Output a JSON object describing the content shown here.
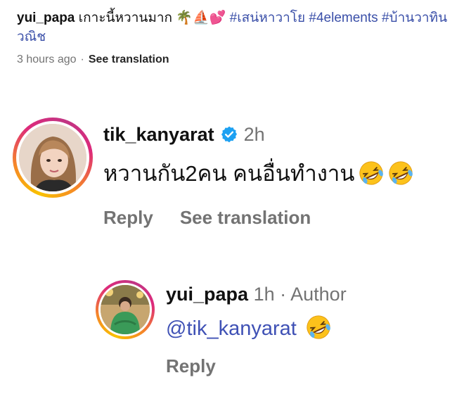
{
  "caption": {
    "username": "yui_papa",
    "text": "เกาะนี้หวานมาก",
    "emojis": "🌴⛵💕",
    "hashtags": [
      "#เสน่หาวาโย",
      "#4elements",
      "#บ้านวาทิน",
      "วณิช"
    ],
    "time": "3 hours ago",
    "see_translation": "See translation"
  },
  "comments": [
    {
      "username": "tik_kanyarat",
      "verified": true,
      "time": "2h",
      "text": "หวานกัน2คน คนอื่นทำงาน",
      "emoji": "rolling-on-floor-laughing",
      "reply_label": "Reply",
      "see_translation": "See translation"
    },
    {
      "username": "yui_papa",
      "time": "1h",
      "separator": "·",
      "author_label": "Author",
      "mention": "@tik_kanyarat",
      "emoji": "rolling-on-floor-laughing",
      "reply_label": "Reply"
    }
  ],
  "colors": {
    "text": "#111111",
    "secondary": "#737373",
    "link": "#3f51b5",
    "verified": "#1da1f2",
    "ring_start": "#f9c200",
    "ring_end": "#c13584"
  }
}
